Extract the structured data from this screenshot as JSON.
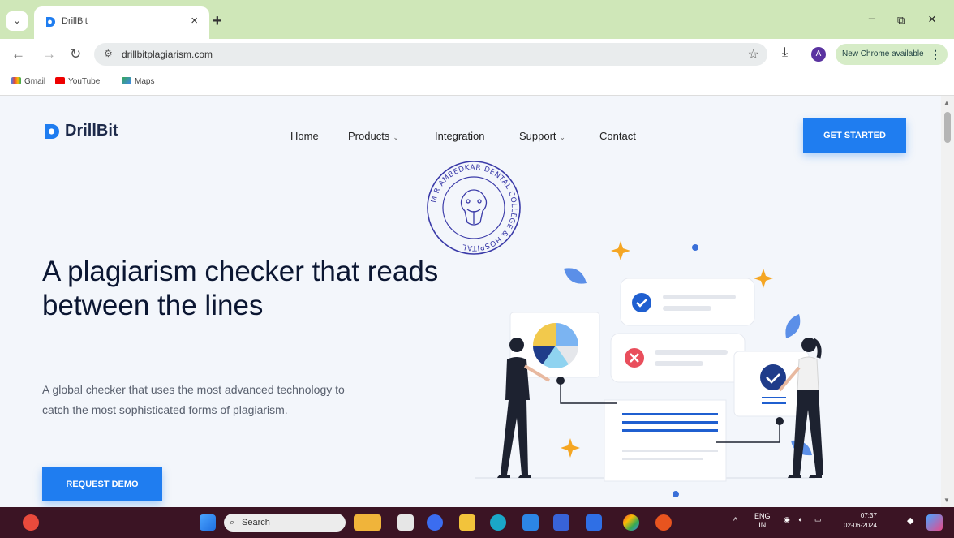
{
  "browser": {
    "tab_title": "DrillBit",
    "tab_close": "×",
    "new_tab": "+",
    "window_controls": [
      "−",
      "⧉",
      "×"
    ],
    "url": "drillbitplagiarism.com",
    "update_label": "New Chrome available",
    "profile_initial": "A",
    "bookmarks": [
      "Gmail",
      "YouTube",
      "Maps"
    ]
  },
  "site": {
    "logo_text": "DrillBit",
    "nav": [
      {
        "label": "Home",
        "caret": ""
      },
      {
        "label": "Products",
        "caret": "⌄"
      },
      {
        "label": "Integration",
        "caret": ""
      },
      {
        "label": "Support",
        "caret": "⌄"
      },
      {
        "label": "Contact",
        "caret": ""
      }
    ],
    "cta_label": "GET STARTED",
    "hero_title": "A plagiarism checker that reads between the lines",
    "hero_sub": "A global checker that uses the most advanced technology to catch the most sophisticated forms of plagiarism.",
    "demo_label": "REQUEST DEMO",
    "stamp_text": "M R AMBEDKAR DENTAL COLLEGE & HOSPITAL"
  },
  "colors": {
    "accent": "#1f7df0",
    "tabbar": "#cfe7b8",
    "taskbar": "#3b1424",
    "stamp": "#3a3aa8"
  },
  "taskbar": {
    "search_placeholder": "Search",
    "lang_line1": "ENG",
    "lang_line2": "IN",
    "time": "07:37",
    "date": "02-06-2024"
  }
}
